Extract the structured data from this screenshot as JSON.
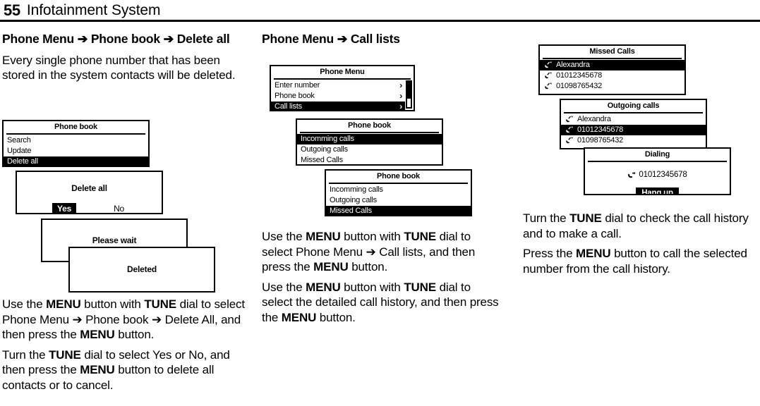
{
  "header": {
    "page_number": "55",
    "title": "Infotainment System"
  },
  "left_column": {
    "section_title": "Phone Menu ➔ Phone book ➔ Delete all",
    "intro": "Every single phone number that has been stored in the system contacts will be deleted.",
    "screens": {
      "phone_book": {
        "title": "Phone book",
        "rows": [
          {
            "label": "Search",
            "selected": false
          },
          {
            "label": "Update",
            "selected": false
          },
          {
            "label": "Delete all",
            "selected": true
          }
        ]
      },
      "delete_all": {
        "title": "Delete all",
        "yes_label": "Yes",
        "no_label": "No"
      },
      "please_wait": {
        "title": "Please wait"
      },
      "deleted": {
        "title": "Deleted"
      }
    },
    "paragraphs": [
      {
        "parts": [
          {
            "t": "Use the ",
            "b": false
          },
          {
            "t": "MENU",
            "b": true
          },
          {
            "t": " button with ",
            "b": false
          },
          {
            "t": "TUNE",
            "b": true
          },
          {
            "t": " dial to select Phone Menu ➔ Phone book ➔ Delete All, and then press the ",
            "b": false
          },
          {
            "t": "MENU",
            "b": true
          },
          {
            "t": " button.",
            "b": false
          }
        ]
      },
      {
        "parts": [
          {
            "t": "Turn the ",
            "b": false
          },
          {
            "t": "TUNE",
            "b": true
          },
          {
            "t": " dial to select Yes or No, and then press the ",
            "b": false
          },
          {
            "t": "MENU",
            "b": true
          },
          {
            "t": " button to delete all contacts or to cancel.",
            "b": false
          }
        ]
      }
    ]
  },
  "middle_column": {
    "section_title": "Phone Menu ➔ Call lists",
    "screens": {
      "phone_menu": {
        "title": "Phone Menu",
        "rows": [
          {
            "label": "Enter number",
            "selected": false,
            "chevron": "›"
          },
          {
            "label": "Phone book",
            "selected": false,
            "chevron": "›"
          },
          {
            "label": "Call lists",
            "selected": true,
            "chevron": "›"
          }
        ],
        "scrollbar": true
      },
      "call_lists_1": {
        "title": "Phone book",
        "rows": [
          {
            "label": "Incomming calls",
            "selected": true
          },
          {
            "label": "Outgoing calls",
            "selected": false
          },
          {
            "label": "Missed Calls",
            "selected": false
          }
        ]
      },
      "call_lists_2": {
        "title": "Phone book",
        "rows": [
          {
            "label": "Incomming calls",
            "selected": false
          },
          {
            "label": "Outgoing calls",
            "selected": false
          },
          {
            "label": "Missed Calls",
            "selected": true
          }
        ]
      }
    },
    "paragraphs": [
      {
        "parts": [
          {
            "t": "Use the ",
            "b": false
          },
          {
            "t": "MENU",
            "b": true
          },
          {
            "t": " button with ",
            "b": false
          },
          {
            "t": "TUNE",
            "b": true
          },
          {
            "t": " dial to select Phone Menu ➔ Call lists, and then press the ",
            "b": false
          },
          {
            "t": "MENU",
            "b": true
          },
          {
            "t": " button.",
            "b": false
          }
        ]
      },
      {
        "parts": [
          {
            "t": "Use the ",
            "b": false
          },
          {
            "t": "MENU",
            "b": true
          },
          {
            "t": " button with ",
            "b": false
          },
          {
            "t": "TUNE",
            "b": true
          },
          {
            "t": " dial to select the detailed call history, and then press the ",
            "b": false
          },
          {
            "t": "MENU",
            "b": true
          },
          {
            "t": " button.",
            "b": false
          }
        ]
      }
    ]
  },
  "right_column": {
    "screens": {
      "missed_calls": {
        "title": "Missed Calls",
        "rows": [
          {
            "label": "Alexandra",
            "selected": true,
            "icon": "missed-call-icon"
          },
          {
            "label": "01012345678",
            "selected": false,
            "icon": "missed-call-icon"
          },
          {
            "label": "01098765432",
            "selected": false,
            "icon": "missed-call-icon"
          }
        ]
      },
      "outgoing_calls": {
        "title": "Outgoing calls",
        "rows": [
          {
            "label": "Alexandra",
            "selected": false,
            "icon": "missed-call-icon"
          },
          {
            "label": "01012345678",
            "selected": true,
            "icon": "missed-call-icon"
          },
          {
            "label": "01098765432",
            "selected": false,
            "icon": "missed-call-icon"
          }
        ]
      },
      "dialing": {
        "title": "Dialing",
        "number": "01012345678",
        "number_icon": "outgoing-call-icon",
        "hang_up_label": "Hang up"
      }
    },
    "paragraphs": [
      {
        "parts": [
          {
            "t": "Turn the ",
            "b": false
          },
          {
            "t": "TUNE",
            "b": true
          },
          {
            "t": " dial to check the call history and to make a call.",
            "b": false
          }
        ]
      },
      {
        "parts": [
          {
            "t": "Press the ",
            "b": false
          },
          {
            "t": "MENU",
            "b": true
          },
          {
            "t": " button to call the selected number from the call history.",
            "b": false
          }
        ]
      }
    ]
  },
  "colors": {
    "ink": "#000000",
    "paper": "#ffffff",
    "highlight_bg": "#000000",
    "highlight_fg": "#ffffff"
  }
}
